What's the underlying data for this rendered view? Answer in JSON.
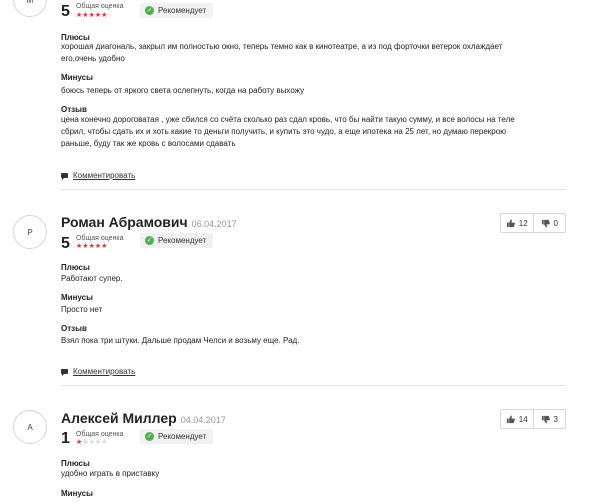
{
  "reviews": [
    {
      "avatar_letter": "М",
      "score": "5",
      "score_label": "Общая оценка",
      "stars_filled": 5,
      "recommend": "Рекомендует",
      "pros_heading": "Плюсы",
      "pros": "хорошая диагональ, закрыл им полностью окно, теперь темно как в кинотеатре, а из под форточки ветерок охлаждает его,очень удобно",
      "cons_heading": "Минусы",
      "cons": "боюсь теперь от яркого света ослепнуть, когда на работу выхожу",
      "comment_heading": "Отзыв",
      "comment": "цена конечно дороговатая , уже сбился со счёта сколько раз сдал кровь, что бы найти такую сумму, и все волосы на теле сбрил, чтобы сдать их и хоть какие то деньги получить, и купить это чудо, а еще ипотека на 25 лет, но думаю перекрою раньше, буду так же кровь с волосами сдавать",
      "comment_link": "Комментировать"
    },
    {
      "avatar_letter": "Р",
      "name": "Роман Абрамович",
      "date": "06.04.2017",
      "score": "5",
      "score_label": "Общая оценка",
      "stars_filled": 5,
      "recommend": "Рекомендует",
      "likes": "12",
      "dislikes": "0",
      "pros_heading": "Плюсы",
      "pros": "Работают супер.",
      "cons_heading": "Минусы",
      "cons": "Просто нет",
      "comment_heading": "Отзыв",
      "comment": "Взял пока три штуки. Дальше продам Челси и возьму еще. Рад.",
      "comment_link": "Комментировать"
    },
    {
      "avatar_letter": "А",
      "name": "Алексей Миллер",
      "date": "04.04.2017",
      "score": "1",
      "score_label": "Общая оценка",
      "stars_filled": 1,
      "recommend": "Рекомендует",
      "likes": "14",
      "dislikes": "3",
      "pros_heading": "Плюсы",
      "pros": "удобно играть в приставку",
      "cons_heading": "Минусы"
    }
  ],
  "colors": {
    "star_on": "#e8313a",
    "star_off": "#d8d8d8",
    "check": "#4caf50"
  },
  "icons": [
    "thumbs-up-icon",
    "thumbs-down-icon",
    "check-icon",
    "comment-icon"
  ]
}
